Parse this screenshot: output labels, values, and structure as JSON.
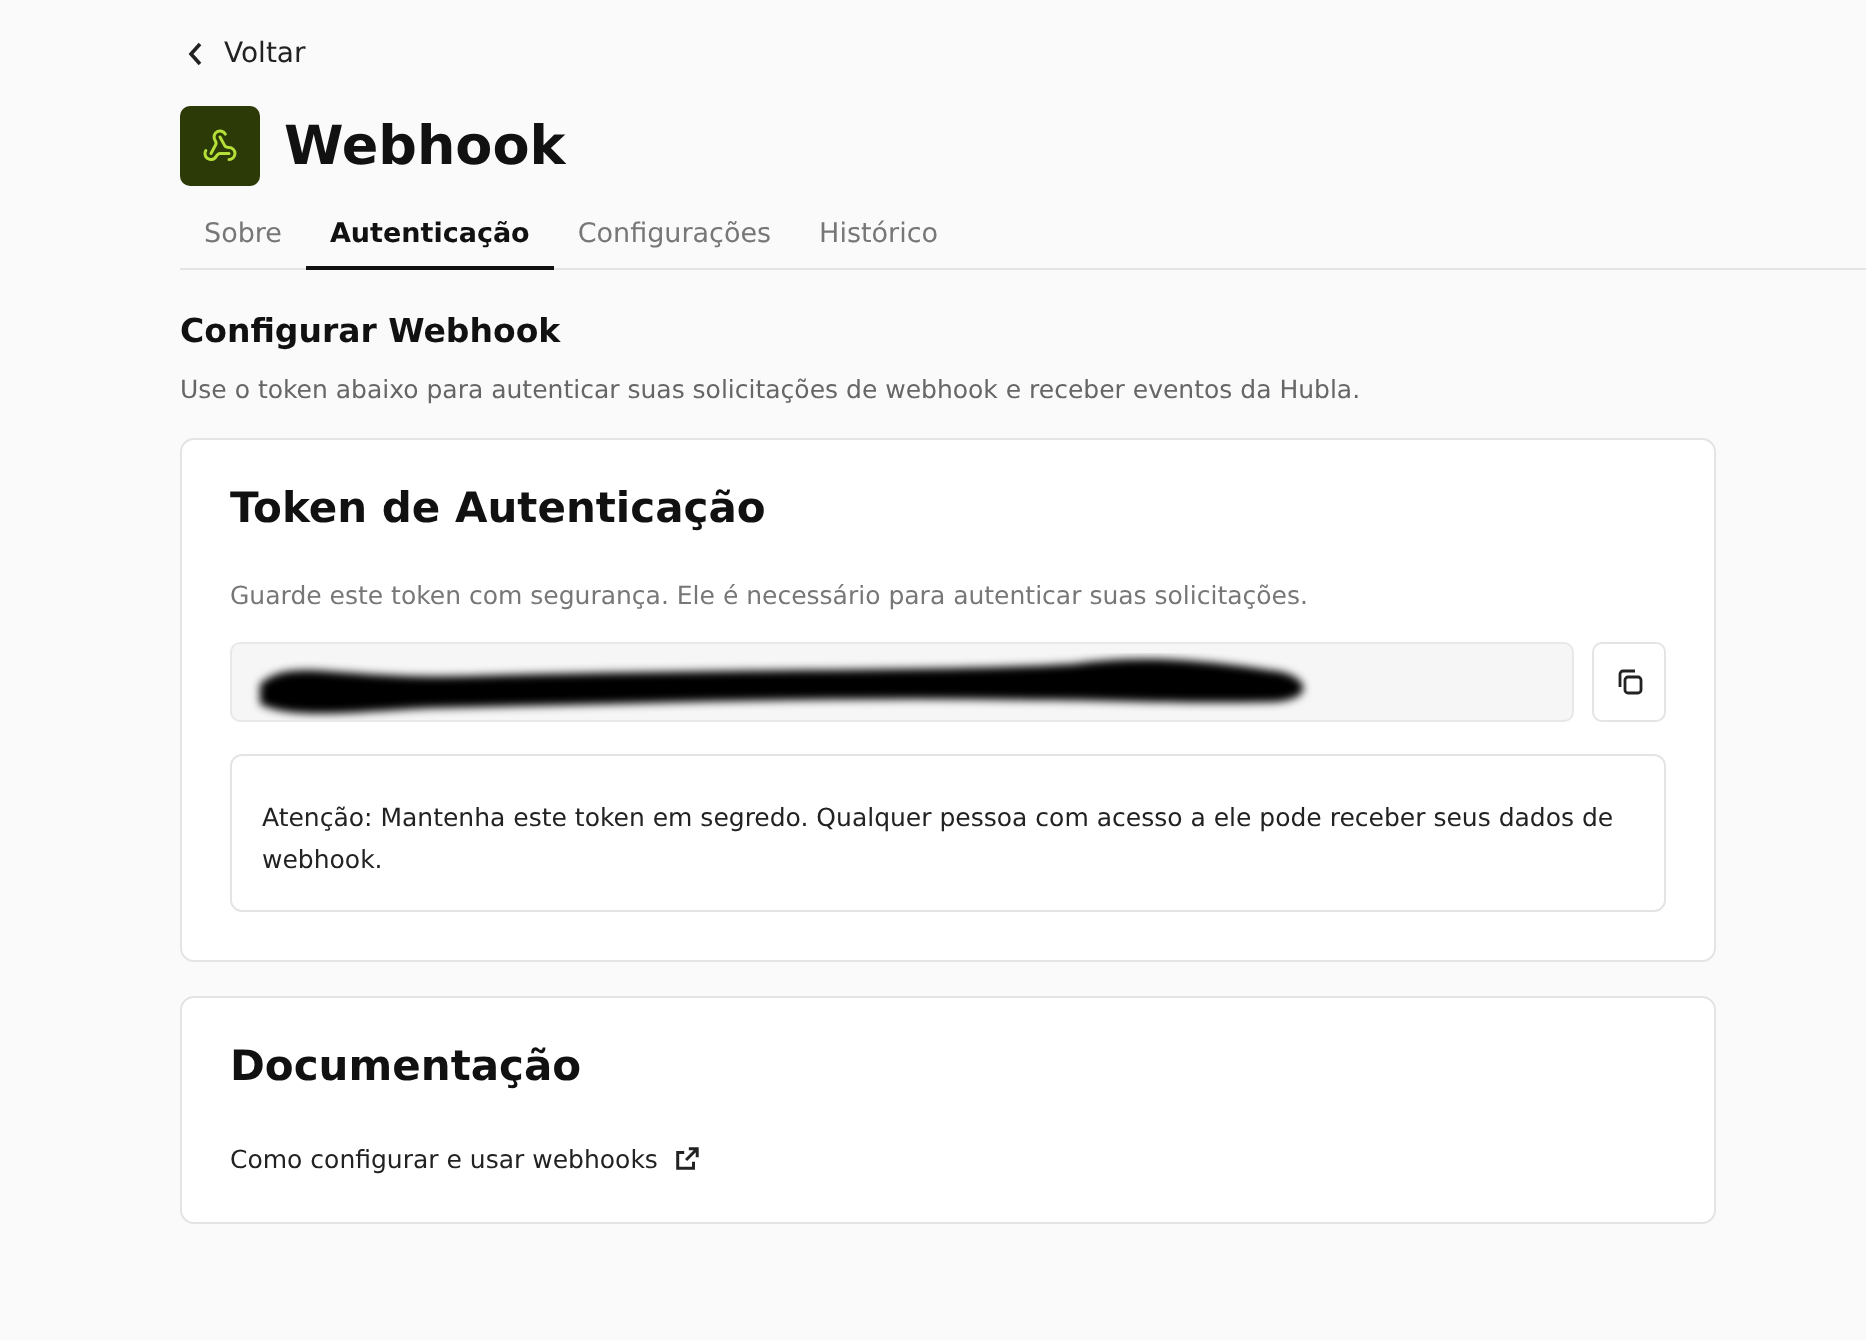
{
  "back_link": "Voltar",
  "header": {
    "title": "Webhook"
  },
  "tabs": [
    {
      "label": "Sobre",
      "selected": false
    },
    {
      "label": "Autenticação",
      "selected": true
    },
    {
      "label": "Configurações",
      "selected": false
    },
    {
      "label": "Histórico",
      "selected": false
    }
  ],
  "section": {
    "title": "Configurar Webhook",
    "description": "Use o token abaixo para autenticar suas solicitações de webhook e receber eventos da Hubla."
  },
  "token_card": {
    "title": "Token de Autenticação",
    "description": "Guarde este token com segurança. Ele é necessário para autenticar suas solicitações.",
    "token_redacted": true,
    "warning": "Atenção: Mantenha este token em segredo. Qualquer pessoa com acesso a ele pode receber seus dados de webhook."
  },
  "docs_card": {
    "title": "Documentação",
    "link": "Como configurar e usar webhooks"
  }
}
